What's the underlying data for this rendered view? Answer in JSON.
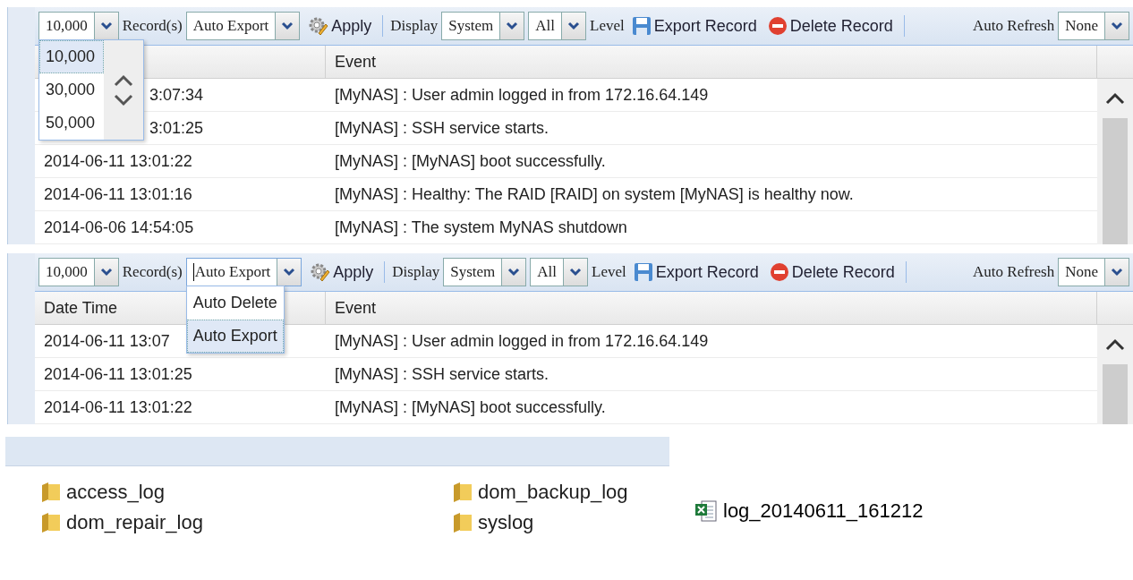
{
  "log_panels": [
    {
      "toolbar": [
        {
          "kind": "select",
          "value": "10,000",
          "focused": false,
          "open": true,
          "scroll_buttons": true,
          "options": [
            {
              "label": "10,000",
              "selected": true
            },
            {
              "label": "30,000",
              "selected": false
            },
            {
              "label": "50,000",
              "selected": false
            }
          ]
        },
        {
          "kind": "label",
          "text": "Record(s)"
        },
        {
          "kind": "select",
          "value": "Auto Export",
          "focused": false,
          "open": false
        },
        {
          "kind": "button",
          "text": "Apply"
        },
        {
          "kind": "separator"
        },
        {
          "kind": "label",
          "text": "Display"
        },
        {
          "kind": "select",
          "value": "System",
          "focused": false,
          "open": false
        },
        {
          "kind": "select",
          "value": "All",
          "focused": false,
          "open": false
        },
        {
          "kind": "label",
          "text": "Level"
        },
        {
          "kind": "button",
          "text": "Export Record"
        },
        {
          "kind": "button",
          "text": "Delete Record"
        },
        {
          "kind": "separator"
        },
        {
          "kind": "label",
          "text": "Auto Refresh"
        },
        {
          "kind": "select",
          "value": "None",
          "focused": false,
          "open": false
        }
      ],
      "columns": {
        "event": "Event"
      },
      "rows": [
        {
          "date": "3:07:34",
          "covered": true,
          "event": "[MyNAS] : User admin logged in from 172.16.64.149"
        },
        {
          "date": "3:01:25",
          "covered": true,
          "event": "[MyNAS] : SSH service starts."
        },
        {
          "date": "2014-06-11 13:01:22",
          "covered": false,
          "event": "[MyNAS] : [MyNAS] boot successfully."
        },
        {
          "date": "2014-06-11 13:01:16",
          "covered": false,
          "event": "[MyNAS] : Healthy: The RAID [RAID] on system [MyNAS] is healthy now."
        },
        {
          "date": "2014-06-06 14:54:05",
          "covered": false,
          "event": "[MyNAS] : The system MyNAS shutdown"
        }
      ]
    },
    {
      "toolbar": [
        {
          "kind": "select",
          "value": "10,000",
          "focused": false,
          "open": false
        },
        {
          "kind": "label",
          "text": "Record(s)"
        },
        {
          "kind": "select",
          "value": "Auto Export",
          "focused": true,
          "open": true,
          "scroll_buttons": false,
          "options": [
            {
              "label": "Auto Delete",
              "selected": false
            },
            {
              "label": "Auto Export",
              "selected": true
            }
          ]
        },
        {
          "kind": "button",
          "text": "Apply"
        },
        {
          "kind": "separator"
        },
        {
          "kind": "label",
          "text": "Display"
        },
        {
          "kind": "select",
          "value": "System",
          "focused": false,
          "open": false
        },
        {
          "kind": "select",
          "value": "All",
          "focused": false,
          "open": false
        },
        {
          "kind": "label",
          "text": "Level"
        },
        {
          "kind": "button",
          "text": "Export Record"
        },
        {
          "kind": "button",
          "text": "Delete Record"
        },
        {
          "kind": "separator"
        },
        {
          "kind": "label",
          "text": "Auto Refresh"
        },
        {
          "kind": "select",
          "value": "None",
          "focused": false,
          "open": false
        }
      ],
      "columns": {
        "date": "Date Time",
        "event": "Event"
      },
      "rows": [
        {
          "date": "2014-06-11 13:07",
          "covered": false,
          "event": "[MyNAS] : User admin logged in from 172.16.64.149"
        },
        {
          "date": "2014-06-11 13:01:25",
          "covered": false,
          "event": "[MyNAS] : SSH service starts."
        },
        {
          "date": "2014-06-11 13:01:22",
          "covered": false,
          "event": "[MyNAS] : [MyNAS] boot successfully."
        }
      ]
    }
  ],
  "folder_window": {
    "folders": [
      "access_log",
      "dom_backup_log",
      "dom_repair_log",
      "syslog"
    ]
  },
  "export_folder": {
    "files": [
      "log_20140611_161212"
    ]
  }
}
